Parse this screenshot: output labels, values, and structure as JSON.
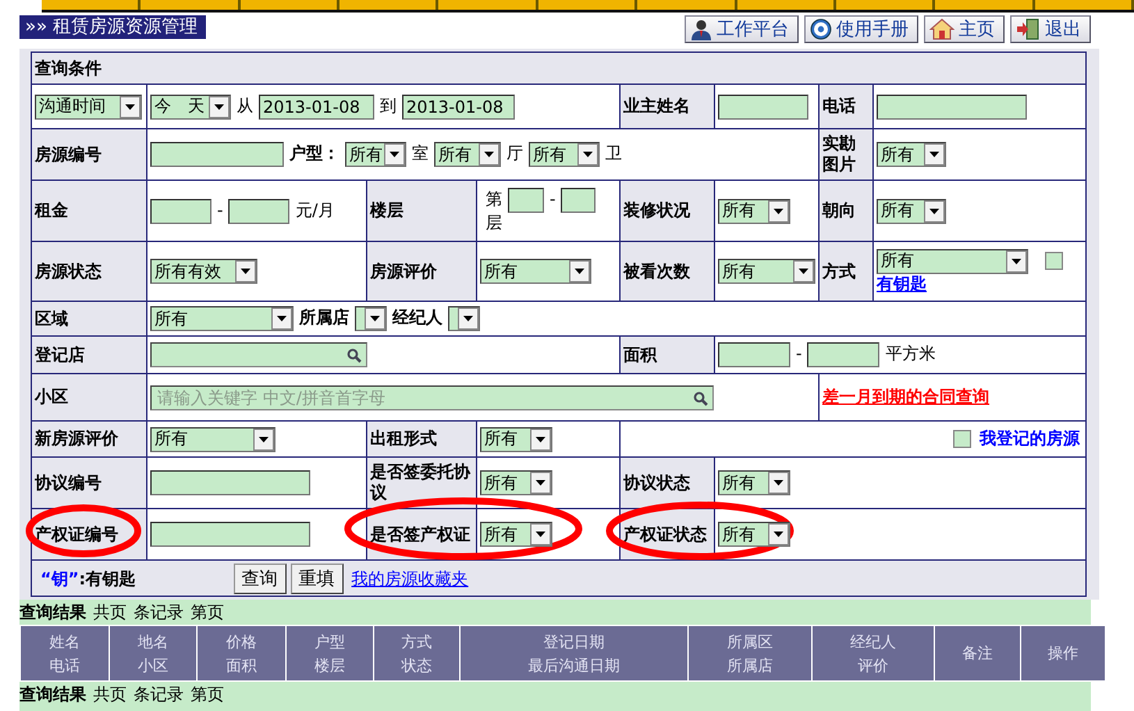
{
  "header": {
    "marker": "»»",
    "title": "租赁房源资源管理"
  },
  "toolbar": [
    {
      "kind": "user",
      "label": "工作平台"
    },
    {
      "kind": "help",
      "label": "使用手册"
    },
    {
      "kind": "home",
      "label": "主页"
    },
    {
      "kind": "exit",
      "label": "退出"
    }
  ],
  "form": {
    "title": "查询条件",
    "rows": [
      {
        "cells": [
          [
            {
              "kind": "select",
              "value": "沟通时间"
            }
          ],
          {
            "colspan": 3,
            "items": [
              {
                "kind": "select",
                "value": "今　天"
              },
              {
                "kind": "text",
                "text": "从"
              },
              {
                "kind": "input",
                "value": "2013-01-08"
              },
              {
                "kind": "text",
                "text": "到"
              },
              {
                "kind": "input",
                "value": "2013-01-08"
              }
            ]
          },
          [
            {
              "kind": "label",
              "text": "业主姓名"
            }
          ],
          [
            {
              "kind": "input"
            }
          ],
          [
            {
              "kind": "label",
              "text": "电话"
            }
          ],
          [
            {
              "kind": "input"
            }
          ]
        ]
      },
      {
        "cells": [
          [
            {
              "kind": "label",
              "text": "房源编号"
            }
          ],
          {
            "colspan": 5,
            "items": [
              {
                "kind": "input"
              },
              {
                "kind": "label",
                "text": "户型："
              },
              {
                "kind": "select",
                "value": "所有"
              },
              {
                "kind": "text",
                "text": "室"
              },
              {
                "kind": "select",
                "value": "所有"
              },
              {
                "kind": "text",
                "text": "厅"
              },
              {
                "kind": "select",
                "value": "所有"
              },
              {
                "kind": "text",
                "text": "卫"
              }
            ]
          },
          [
            {
              "kind": "label",
              "text": "实勘图片"
            }
          ],
          [
            {
              "kind": "select",
              "value": "所有"
            }
          ]
        ]
      },
      {
        "cells": [
          [
            {
              "kind": "label",
              "text": "租金"
            }
          ],
          [
            {
              "kind": "input"
            },
            {
              "kind": "text",
              "text": "-"
            },
            {
              "kind": "input"
            },
            {
              "kind": "text",
              "text": "元/月"
            }
          ],
          [
            {
              "kind": "label",
              "text": "楼层"
            }
          ],
          [
            {
              "kind": "text",
              "text": "第"
            },
            {
              "kind": "input"
            },
            {
              "kind": "text",
              "text": "-"
            },
            {
              "kind": "input"
            },
            {
              "kind": "text",
              "text": "层"
            }
          ],
          [
            {
              "kind": "label",
              "text": "装修状况"
            }
          ],
          [
            {
              "kind": "select",
              "value": "所有"
            }
          ],
          [
            {
              "kind": "label",
              "text": "朝向"
            }
          ],
          [
            {
              "kind": "select",
              "value": "所有"
            }
          ]
        ]
      },
      {
        "cells": [
          [
            {
              "kind": "label",
              "text": "房源状态"
            }
          ],
          [
            {
              "kind": "select",
              "value": "所有有效"
            }
          ],
          [
            {
              "kind": "label",
              "text": "房源评价"
            }
          ],
          [
            {
              "kind": "select",
              "value": "所有"
            }
          ],
          [
            {
              "kind": "label",
              "text": "被看次数"
            }
          ],
          [
            {
              "kind": "select",
              "value": "所有"
            }
          ],
          [
            {
              "kind": "label",
              "text": "方式"
            }
          ],
          [
            {
              "kind": "select",
              "value": "所有"
            },
            {
              "kind": "checkbox",
              "checked": false
            },
            {
              "kind": "link",
              "text": "有钥匙"
            }
          ]
        ]
      },
      {
        "cells": [
          [
            {
              "kind": "label",
              "text": "区域"
            }
          ],
          {
            "colspan": 7,
            "items": [
              {
                "kind": "select",
                "value": "所有"
              },
              {
                "kind": "label",
                "text": "所属店"
              },
              {
                "kind": "select"
              },
              {
                "kind": "label",
                "text": "经纪人"
              },
              {
                "kind": "select"
              }
            ]
          }
        ]
      },
      {
        "cells": [
          [
            {
              "kind": "label",
              "text": "登记店"
            }
          ],
          {
            "colspan": 3,
            "items": [
              {
                "kind": "search"
              }
            ]
          },
          [
            {
              "kind": "label",
              "text": "面积"
            }
          ],
          {
            "colspan": 3,
            "items": [
              {
                "kind": "input"
              },
              {
                "kind": "text",
                "text": "-"
              },
              {
                "kind": "input"
              },
              {
                "kind": "text",
                "text": "平方米"
              }
            ]
          }
        ]
      },
      {
        "cells": [
          [
            {
              "kind": "label",
              "text": "小区"
            }
          ],
          {
            "colspan": 5,
            "items": [
              {
                "kind": "search",
                "placeholder": "请输入关键字 中文/拼音首字母"
              }
            ]
          },
          {
            "colspan": 2,
            "items": [
              {
                "kind": "alert",
                "text": "差一月到期的合同查询"
              }
            ]
          }
        ]
      },
      {
        "cells": [
          [
            {
              "kind": "label",
              "text": "新房源评价"
            }
          ],
          [
            {
              "kind": "select",
              "value": "所有"
            }
          ],
          [
            {
              "kind": "label",
              "text": "出租形式"
            }
          ],
          [
            {
              "kind": "select",
              "value": "所有"
            }
          ],
          {
            "colspan": 4,
            "items": [
              {
                "kind": "checkbox",
                "checked": false
              },
              {
                "kind": "note",
                "text": "我登记的房源"
              }
            ]
          }
        ]
      },
      {
        "cells": [
          [
            {
              "kind": "label",
              "text": "协议编号"
            }
          ],
          [
            {
              "kind": "input"
            }
          ],
          [
            {
              "kind": "label",
              "text": "是否签委托协议"
            }
          ],
          [
            {
              "kind": "select",
              "value": "所有"
            }
          ],
          [
            {
              "kind": "label",
              "text": "协议状态"
            }
          ],
          {
            "colspan": 3,
            "items": [
              {
                "kind": "select",
                "value": "所有"
              }
            ]
          }
        ]
      },
      {
        "cells": [
          [
            {
              "kind": "label",
              "text": "产权证编号",
              "circled": true
            }
          ],
          [
            {
              "kind": "input"
            }
          ],
          [
            {
              "kind": "label",
              "text": "是否签产权证",
              "circled": true
            }
          ],
          [
            {
              "kind": "select",
              "value": "所有"
            }
          ],
          [
            {
              "kind": "label",
              "text": "产权证状态",
              "circled": true
            }
          ],
          {
            "colspan": 3,
            "items": [
              {
                "kind": "select",
                "value": "所有"
              }
            ]
          }
        ]
      }
    ],
    "footer": {
      "key": "“钥”",
      "key_text": ":有钥匙",
      "buttons": [
        "查询",
        "重填"
      ],
      "link": "我的房源收藏夹"
    }
  },
  "results": {
    "summary": [
      {
        "kind": "title",
        "text": "查询结果"
      },
      {
        "kind": "text",
        "text": "共页"
      },
      {
        "kind": "text",
        "text": "条记录"
      },
      {
        "kind": "text",
        "text": "第页"
      }
    ],
    "columns": [
      [
        "姓名",
        "电话"
      ],
      [
        "地名",
        "小区"
      ],
      [
        "价格",
        "面积"
      ],
      [
        "户型",
        "楼层"
      ],
      [
        "方式",
        "状态"
      ],
      [
        "登记日期",
        "最后沟通日期"
      ],
      [
        "所属区",
        "所属店"
      ],
      [
        "经纪人",
        "评价"
      ],
      [
        "备注"
      ],
      [
        "操作"
      ]
    ],
    "bottom_summary": [
      {
        "kind": "title",
        "text": "查询结果"
      },
      {
        "kind": "text",
        "text": "共页"
      },
      {
        "kind": "text",
        "text": "条记录"
      },
      {
        "kind": "text",
        "text": "第页"
      }
    ]
  }
}
